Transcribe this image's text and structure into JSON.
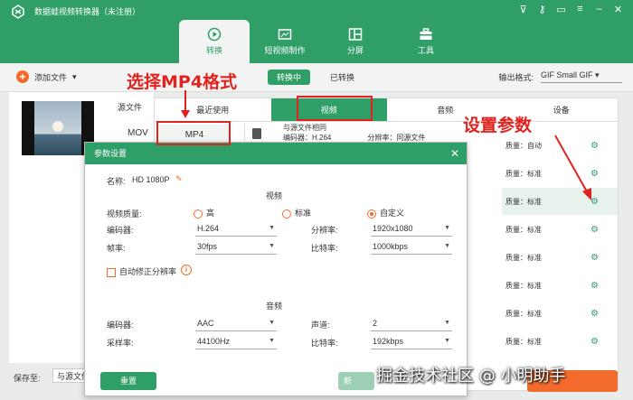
{
  "app": {
    "title": "数据蛙视频转换器（未注册）"
  },
  "nav": {
    "tabs": [
      {
        "label": "转换",
        "icon": "convert-icon"
      },
      {
        "label": "短视频制作",
        "icon": "tv-icon"
      },
      {
        "label": "分屏",
        "icon": "split-screen-icon"
      },
      {
        "label": "工具",
        "icon": "toolbox-icon"
      }
    ],
    "active": "转换"
  },
  "toolbar": {
    "add_file": "添加文件",
    "tab_converting": "转换中",
    "tab_converted": "已转换",
    "output_label": "输出格式:",
    "output_value": "GIF Small GIF"
  },
  "file": {
    "source_label": "源文件",
    "format": "MOV"
  },
  "format_panel": {
    "tabs": [
      "最近使用",
      "视频",
      "音频",
      "设备"
    ],
    "active_tab": "视频",
    "selected_format": "MP4",
    "preset": {
      "line1": "与源文件相同",
      "encoder": "编码器：H.264",
      "resolution": "分辨率：同源文件"
    },
    "qualities": [
      "质量：自动",
      "质量：标准",
      "质量：标准",
      "质量：标准",
      "质量：标准",
      "质量：标准",
      "质量：标准",
      "质量：标准"
    ]
  },
  "dialog": {
    "title": "参数设置",
    "name_label": "名称:",
    "name_value": "HD 1080P",
    "video_section": "视频",
    "quality_label": "视频质量:",
    "quality_options": [
      "高",
      "标准",
      "自定义"
    ],
    "quality_selected": "自定义",
    "encoder_label": "编码器:",
    "encoder_value": "H.264",
    "resolution_label": "分辨率:",
    "resolution_value": "1920x1080",
    "fps_label": "帧率:",
    "fps_value": "30fps",
    "bitrate_label": "比特率:",
    "bitrate_value": "1000kbps",
    "auto_fix_label": "自动修正分辨率",
    "audio_section": "音频",
    "a_encoder_label": "编码器:",
    "a_encoder_value": "AAC",
    "channel_label": "声道:",
    "channel_value": "2",
    "samplerate_label": "采样率:",
    "samplerate_value": "44100Hz",
    "a_bitrate_label": "比特率:",
    "a_bitrate_value": "192kbps",
    "reset_label": "重置",
    "new_label": "新"
  },
  "bottom": {
    "save_to_label": "保存至:",
    "save_to_value": "与源文件"
  },
  "annotations": {
    "select_mp4": "选择MP4格式",
    "set_params": "设置参数"
  },
  "watermark": "掘金技术社区 @ 小明助手",
  "colors": {
    "brand": "#2f9e67",
    "accent": "#f26b2c",
    "annotation": "#e0231f"
  }
}
